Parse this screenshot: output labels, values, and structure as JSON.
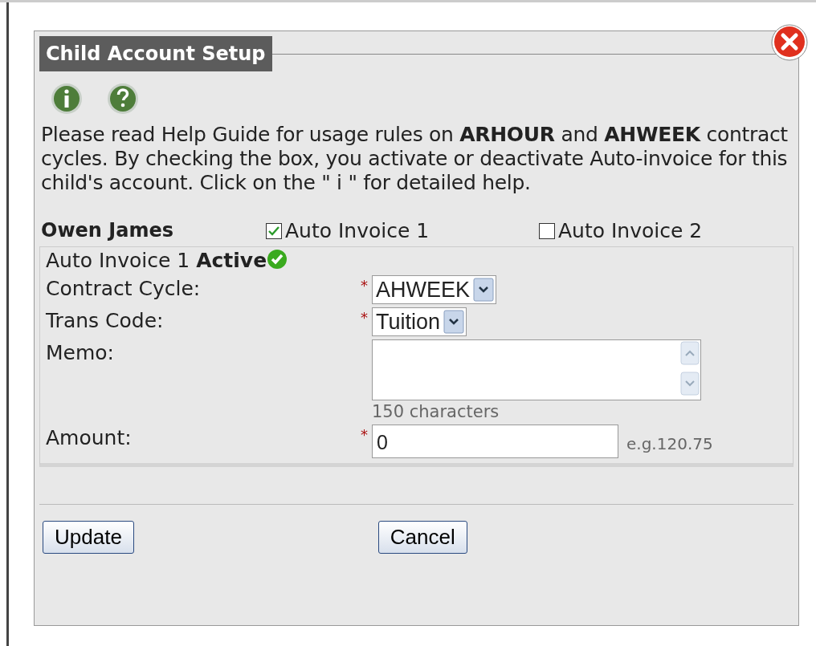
{
  "dialog": {
    "title": "Child Account Setup"
  },
  "intro": "Please read Help Guide for usage rules on **ARHOUR** and **AHWEEK** contract cycles. By checking the box, you activate or deactivate Auto-invoice for this child's account. Click on the \" i \" for detailed help.",
  "child_name": "Owen James",
  "invoices": [
    {
      "label": "Auto Invoice 1",
      "checked": true
    },
    {
      "label": "Auto Invoice 2",
      "checked": false
    }
  ],
  "status": "Auto Invoice 1 **Active**",
  "fields": [
    {
      "kind": "select",
      "label": "Contract Cycle:",
      "marker": "*",
      "value": "AHWEEK"
    },
    {
      "kind": "select",
      "label": "Trans Code:",
      "marker": "*",
      "value": "Tuition"
    },
    {
      "kind": "textarea",
      "label": "Memo:",
      "hint": "150 characters"
    },
    {
      "kind": "text",
      "label": "Amount:",
      "marker": "*",
      "value": "0",
      "suffix": "e.g.120.75"
    }
  ],
  "buttons": [
    {
      "label": "Update"
    },
    {
      "label": "Cancel"
    }
  ]
}
